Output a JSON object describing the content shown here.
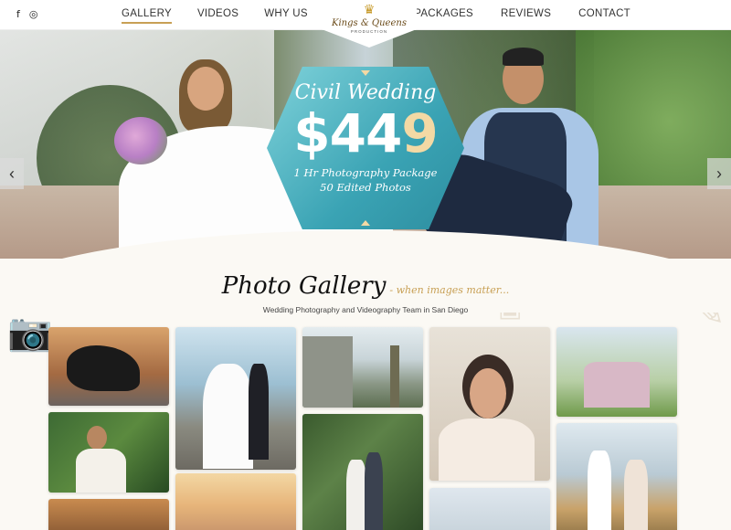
{
  "nav": {
    "social": {
      "facebook_glyph": "f",
      "instagram_glyph": "◎"
    },
    "left_items": [
      "GALLERY",
      "VIDEOS",
      "WHY US"
    ],
    "right_items": [
      "PACKAGES",
      "REVIEWS",
      "CONTACT"
    ],
    "active": "GALLERY"
  },
  "logo": {
    "crown": "♛",
    "brand": "Kings & Queens",
    "sub": "PRODUCTION"
  },
  "hero": {
    "badge_title": "Civil Wedding",
    "badge_price_dollar": "$",
    "badge_price_white": "44",
    "badge_price_gold": "9",
    "badge_line1": "1 Hr Photography Package",
    "badge_line2": "50 Edited Photos",
    "prev_glyph": "‹",
    "next_glyph": "›",
    "badge_colors": [
      "#7fd2da",
      "#3aa3b4",
      "#2d8ea0"
    ]
  },
  "gallery": {
    "title": "Photo Gallery",
    "tagline": "- when images matter...",
    "subtitle": "Wedding Photography and Videography Team in San Diego"
  },
  "colors": {
    "accent_gold": "#c8a055",
    "background": "#fbf9f4"
  },
  "icons": [
    "facebook-icon",
    "instagram-icon",
    "chevron-left-icon",
    "chevron-right-icon",
    "crown-icon",
    "camera-icon"
  ]
}
